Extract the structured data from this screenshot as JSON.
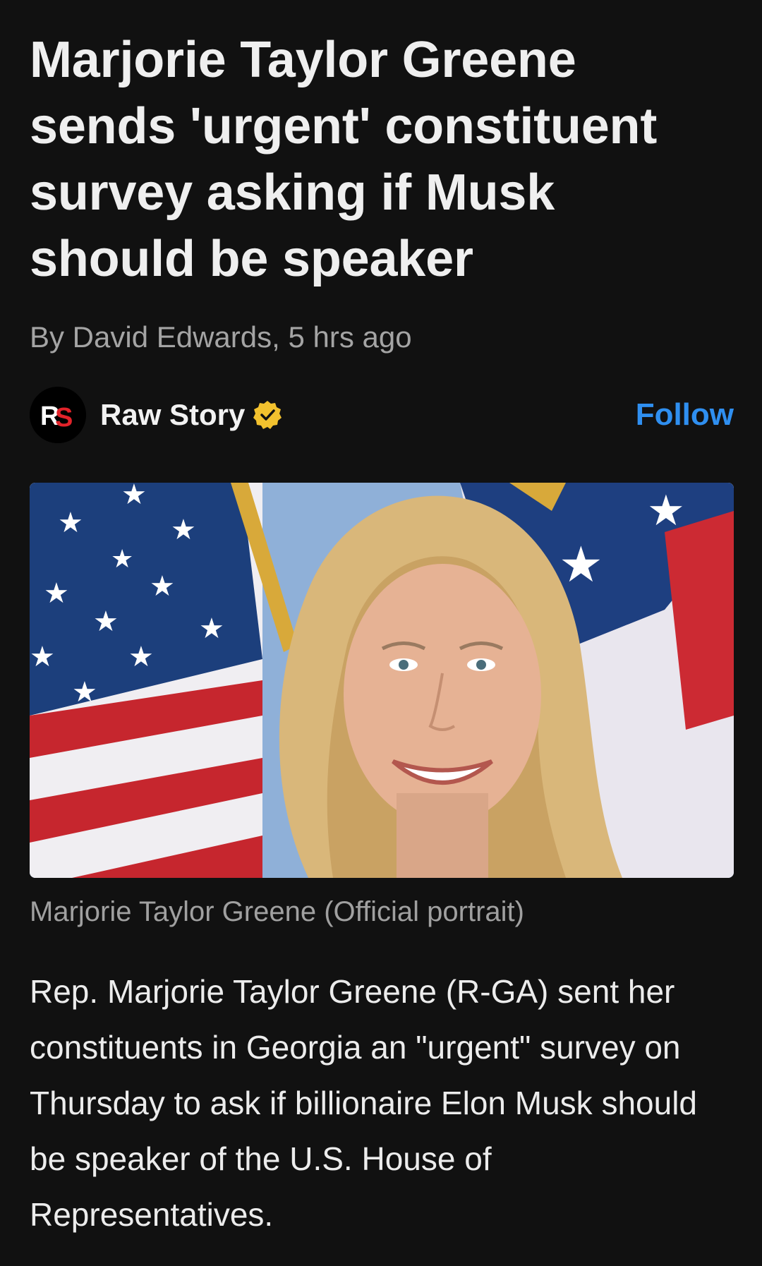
{
  "article": {
    "headline": "Marjorie Taylor Greene sends 'urgent' constituent survey asking if Musk should be speaker",
    "byline": "By David Edwards, 5 hrs ago",
    "caption": "Marjorie Taylor Greene (Official portrait)",
    "body": "Rep. Marjorie Taylor Greene (R-GA) sent her constituents in Georgia an \"urgent\" survey on Thursday to ask if billionaire Elon Musk should be speaker of the U.S. House of Representatives."
  },
  "source": {
    "name": "Raw Story",
    "logo_text": "RS",
    "follow_label": "Follow",
    "logo_icon": "raw-story-logo",
    "verified_icon": "verified-badge-icon"
  },
  "colors": {
    "background": "#111111",
    "accent": "#2f8ff0",
    "verified": "#f2c12e",
    "logo_red": "#e2232a"
  }
}
